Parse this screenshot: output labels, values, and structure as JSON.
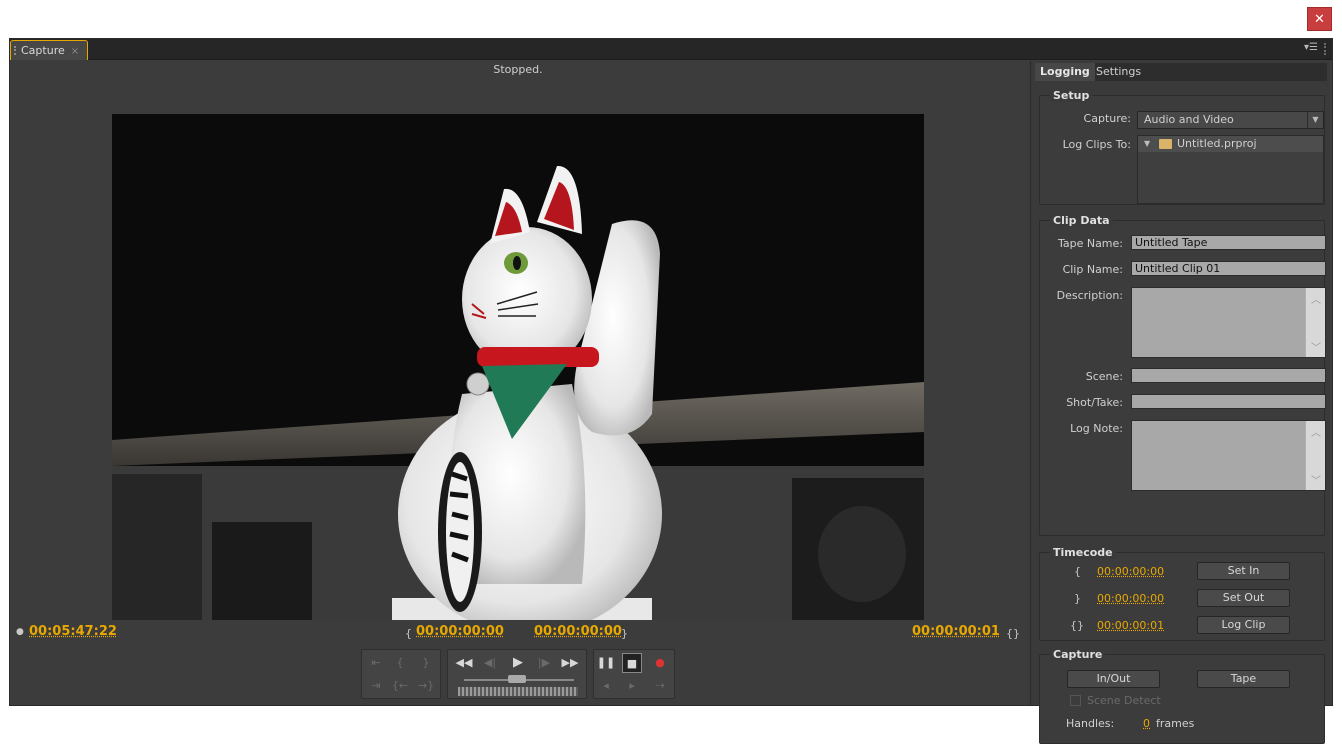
{
  "window": {
    "close_glyph": "✕"
  },
  "panel": {
    "tab_label": "Capture",
    "tab_close_glyph": "×",
    "menu_glyph": "▾☰"
  },
  "monitor": {
    "status": "Stopped.",
    "current_timecode": "00:05:47:22",
    "in_point": "00:00:00:00",
    "out_point": "00:00:00:00",
    "duration": "00:00:00:01",
    "in_bracket": "{",
    "out_bracket": "}",
    "duration_glyph": "{}"
  },
  "transport": {
    "rewind": "◀◀",
    "step_back": "◀|",
    "play": "▶",
    "step_forward": "|▶",
    "fast_forward": "▶▶",
    "pause": "❚❚",
    "stop": "■",
    "record": "●"
  },
  "logger": {
    "tabs": [
      {
        "label": "Logging",
        "active": true
      },
      {
        "label": "Settings",
        "active": false
      }
    ],
    "setup": {
      "title": "Setup",
      "capture_label": "Capture:",
      "capture_value": "Audio and Video",
      "log_clips_label": "Log Clips To:",
      "project_name": "Untitled.prproj"
    },
    "clip_data": {
      "title": "Clip Data",
      "tape_name_label": "Tape Name:",
      "tape_name_value": "Untitled Tape",
      "clip_name_label": "Clip Name:",
      "clip_name_value": "Untitled Clip 01",
      "description_label": "Description:",
      "scene_label": "Scene:",
      "shot_take_label": "Shot/Take:",
      "log_note_label": "Log Note:"
    },
    "timecode": {
      "title": "Timecode",
      "in_glyph": "{",
      "out_glyph": "}",
      "dur_glyph": "{}",
      "in_value": "00:00:00:00",
      "out_value": "00:00:00:00",
      "dur_value": "00:00:00:01",
      "set_in": "Set In",
      "set_out": "Set Out",
      "log_clip": "Log Clip"
    },
    "capture": {
      "title": "Capture",
      "in_out": "In/Out",
      "tape": "Tape",
      "scene_detect": "Scene Detect",
      "handles_label": "Handles:",
      "handles_value": "0",
      "handles_unit": "frames"
    }
  },
  "colors": {
    "accent": "#e8a800",
    "panel_bg": "#3c3c3c",
    "close_red": "#c83d3d"
  }
}
